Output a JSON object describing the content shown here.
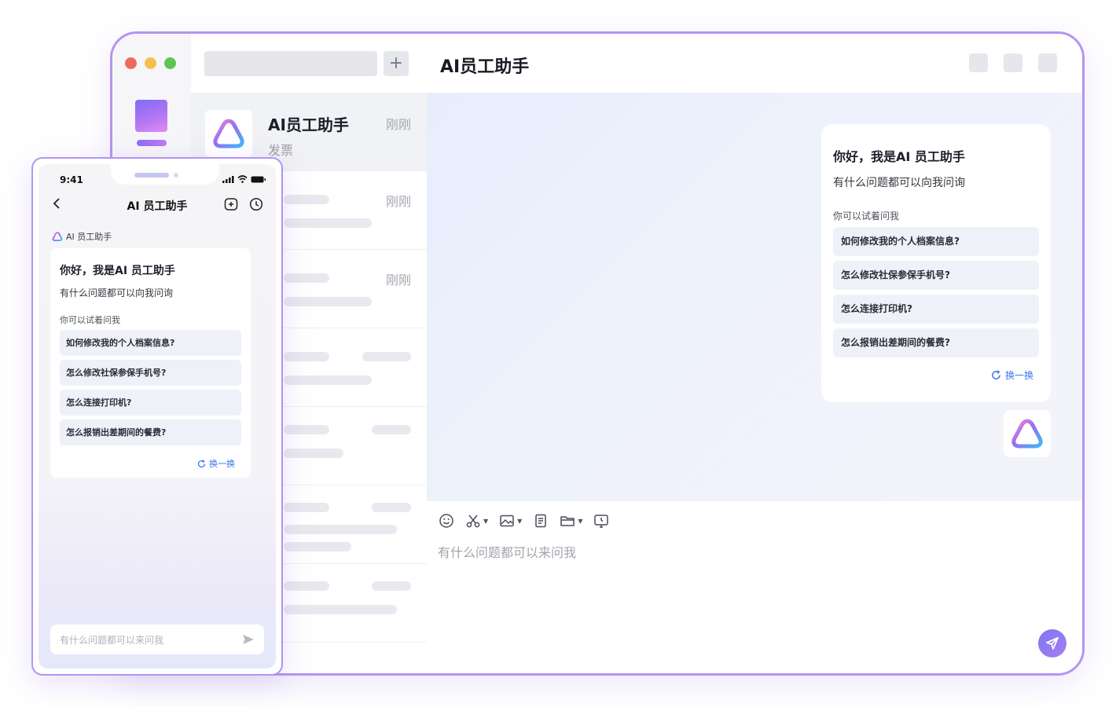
{
  "window": {
    "traffic_lights": [
      "#ec6b5e",
      "#f4bf4f",
      "#61c554"
    ],
    "accent": "#b394f2"
  },
  "list": {
    "new_chat_icon": "+",
    "active": {
      "title": "AI员工助手",
      "subtitle": "发票",
      "time": "刚刚"
    },
    "rows": [
      {
        "time": "刚刚"
      },
      {
        "time": "刚刚"
      }
    ]
  },
  "chat": {
    "title": "AI员工助手",
    "greeting": "你好，我是AI 员工助手",
    "greeting_sub": "有什么问题都可以向我问询",
    "try_label": "你可以试着问我",
    "suggestions": [
      "如何修改我的个人档案信息?",
      "怎么修改社保参保手机号?",
      "怎么连接打印机?",
      "怎么报销出差期间的餐费?"
    ],
    "refresh": "换一换",
    "composer_placeholder": "有什么问题都可以来问我",
    "toolbar_icons": [
      "emoji-icon",
      "scissors-icon",
      "image-icon",
      "document-icon",
      "folder-icon",
      "screen-record-icon"
    ]
  },
  "phone": {
    "time": "9:41",
    "title": "AI 员工助手",
    "source": "AI 员工助手",
    "greeting": "你好，我是AI 员工助手",
    "greeting_sub": "有什么问题都可以向我问询",
    "try_label": "你可以试着问我",
    "suggestions": [
      "如何修改我的个人档案信息?",
      "怎么修改社保参保手机号?",
      "怎么连接打印机?",
      "怎么报销出差期间的餐费?"
    ],
    "refresh": "换一换",
    "input_placeholder": "有什么问题都可以来问我"
  }
}
